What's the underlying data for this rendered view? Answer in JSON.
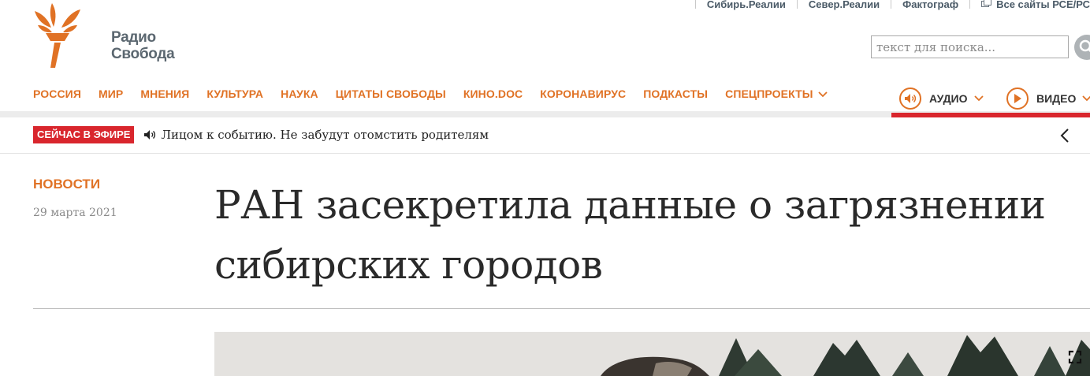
{
  "toplinks": [
    {
      "label": "Сибирь.Реалии"
    },
    {
      "label": "Север.Реалии"
    },
    {
      "label": "Фактограф"
    },
    {
      "label": "Все сайты РСЕ/РС"
    }
  ],
  "logo": {
    "line1": "Радио",
    "line2": "Свобода"
  },
  "search": {
    "placeholder": "текст для поиска..."
  },
  "nav": {
    "items": [
      {
        "label": "РОССИЯ"
      },
      {
        "label": "МИР"
      },
      {
        "label": "МНЕНИЯ"
      },
      {
        "label": "КУЛЬТУРА"
      },
      {
        "label": "НАУКА"
      },
      {
        "label": "ЦИТАТЫ СВОБОДЫ"
      },
      {
        "label": "КИНО.DOC"
      },
      {
        "label": "КОРОНАВИРУС"
      },
      {
        "label": "ПОДКАСТЫ"
      },
      {
        "label": "СПЕЦПРОЕКТЫ"
      }
    ],
    "audio": "АУДИО",
    "video": "ВИДЕО"
  },
  "onair": {
    "badge": "СЕЙЧАС В ЭФИРЕ",
    "text": "Лицом к событию. Не забудут отомстить родителям"
  },
  "article": {
    "section": "НОВОСТИ",
    "date": "29 марта 2021",
    "headline": "РАН засекретила данные о загрязнении сибирских городов"
  },
  "colors": {
    "accent": "#e07225",
    "live_red": "#d9262d",
    "muted": "#4a5a67"
  }
}
